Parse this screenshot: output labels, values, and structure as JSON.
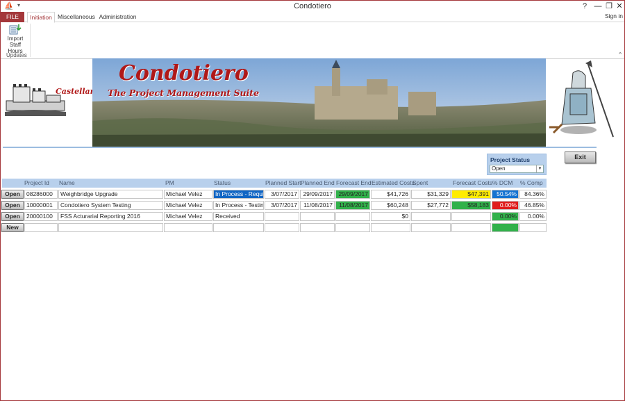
{
  "window": {
    "title": "Condotiero",
    "help": "?",
    "minimize": "—",
    "restore": "❐",
    "close": "✕"
  },
  "ribbon": {
    "tabs": [
      {
        "label": "FILE"
      },
      {
        "label": "Initiation"
      },
      {
        "label": "Miscellaneous"
      },
      {
        "label": "Administration"
      }
    ],
    "sign_in": "Sign in",
    "import_line1": "Import",
    "import_line2": "Staff Hours",
    "group_label": "Updates",
    "collapse": "^"
  },
  "banner": {
    "logo_text": "Castellan",
    "title": "Condotiero",
    "subtitle": "The Project Management Suite"
  },
  "filter": {
    "label": "Project Status Filter",
    "value": "Open"
  },
  "exit_label": "Exit",
  "grid": {
    "columns": [
      "Project Id",
      "Name",
      "PM",
      "Status",
      "Planned Start",
      "Planned End",
      "Forecast End",
      "Estimated Costs",
      "Spent",
      "Forecast Costs",
      "% DCM",
      "% Comp"
    ],
    "rows": [
      {
        "btn": "Open",
        "id": "08286000",
        "name": "Weighbridge Upgrade",
        "pm": "Michael Velez",
        "status": "In Process - Requirem",
        "pstart": "3/07/2017",
        "pend": "29/09/2017",
        "fend": "29/09/2017",
        "est": "$41,726",
        "spent": "$31,329",
        "fcost": "$47,391",
        "dcm": "50.54%",
        "comp": "84.36%"
      },
      {
        "btn": "Open",
        "id": "10000001",
        "name": "Condotiero System Testing",
        "pm": "Michael Velez",
        "status": "In Process - Testing",
        "pstart": "3/07/2017",
        "pend": "11/08/2017",
        "fend": "11/08/2017",
        "est": "$60,248",
        "spent": "$27,772",
        "fcost": "$58,183",
        "dcm": "0.00%",
        "comp": "46.85%"
      },
      {
        "btn": "Open",
        "id": "20000100",
        "name": "FSS Acturarial Reporting 2016",
        "pm": "Michael Velez",
        "status": "Received",
        "pstart": "",
        "pend": "",
        "fend": "",
        "est": "$0",
        "spent": "",
        "fcost": "",
        "dcm": "0.00%",
        "comp": "0.00%"
      },
      {
        "btn": "New",
        "id": "",
        "name": "",
        "pm": "",
        "status": "",
        "pstart": "",
        "pend": "",
        "fend": "",
        "est": "",
        "spent": "",
        "fcost": "",
        "dcm": "",
        "comp": ""
      }
    ]
  },
  "colors": {
    "accent": "#a4373a",
    "header": "#b8d0ec",
    "green": "#31b14a",
    "yellow": "#ffec00",
    "blue": "#1573d1",
    "red": "#e01b1b"
  }
}
